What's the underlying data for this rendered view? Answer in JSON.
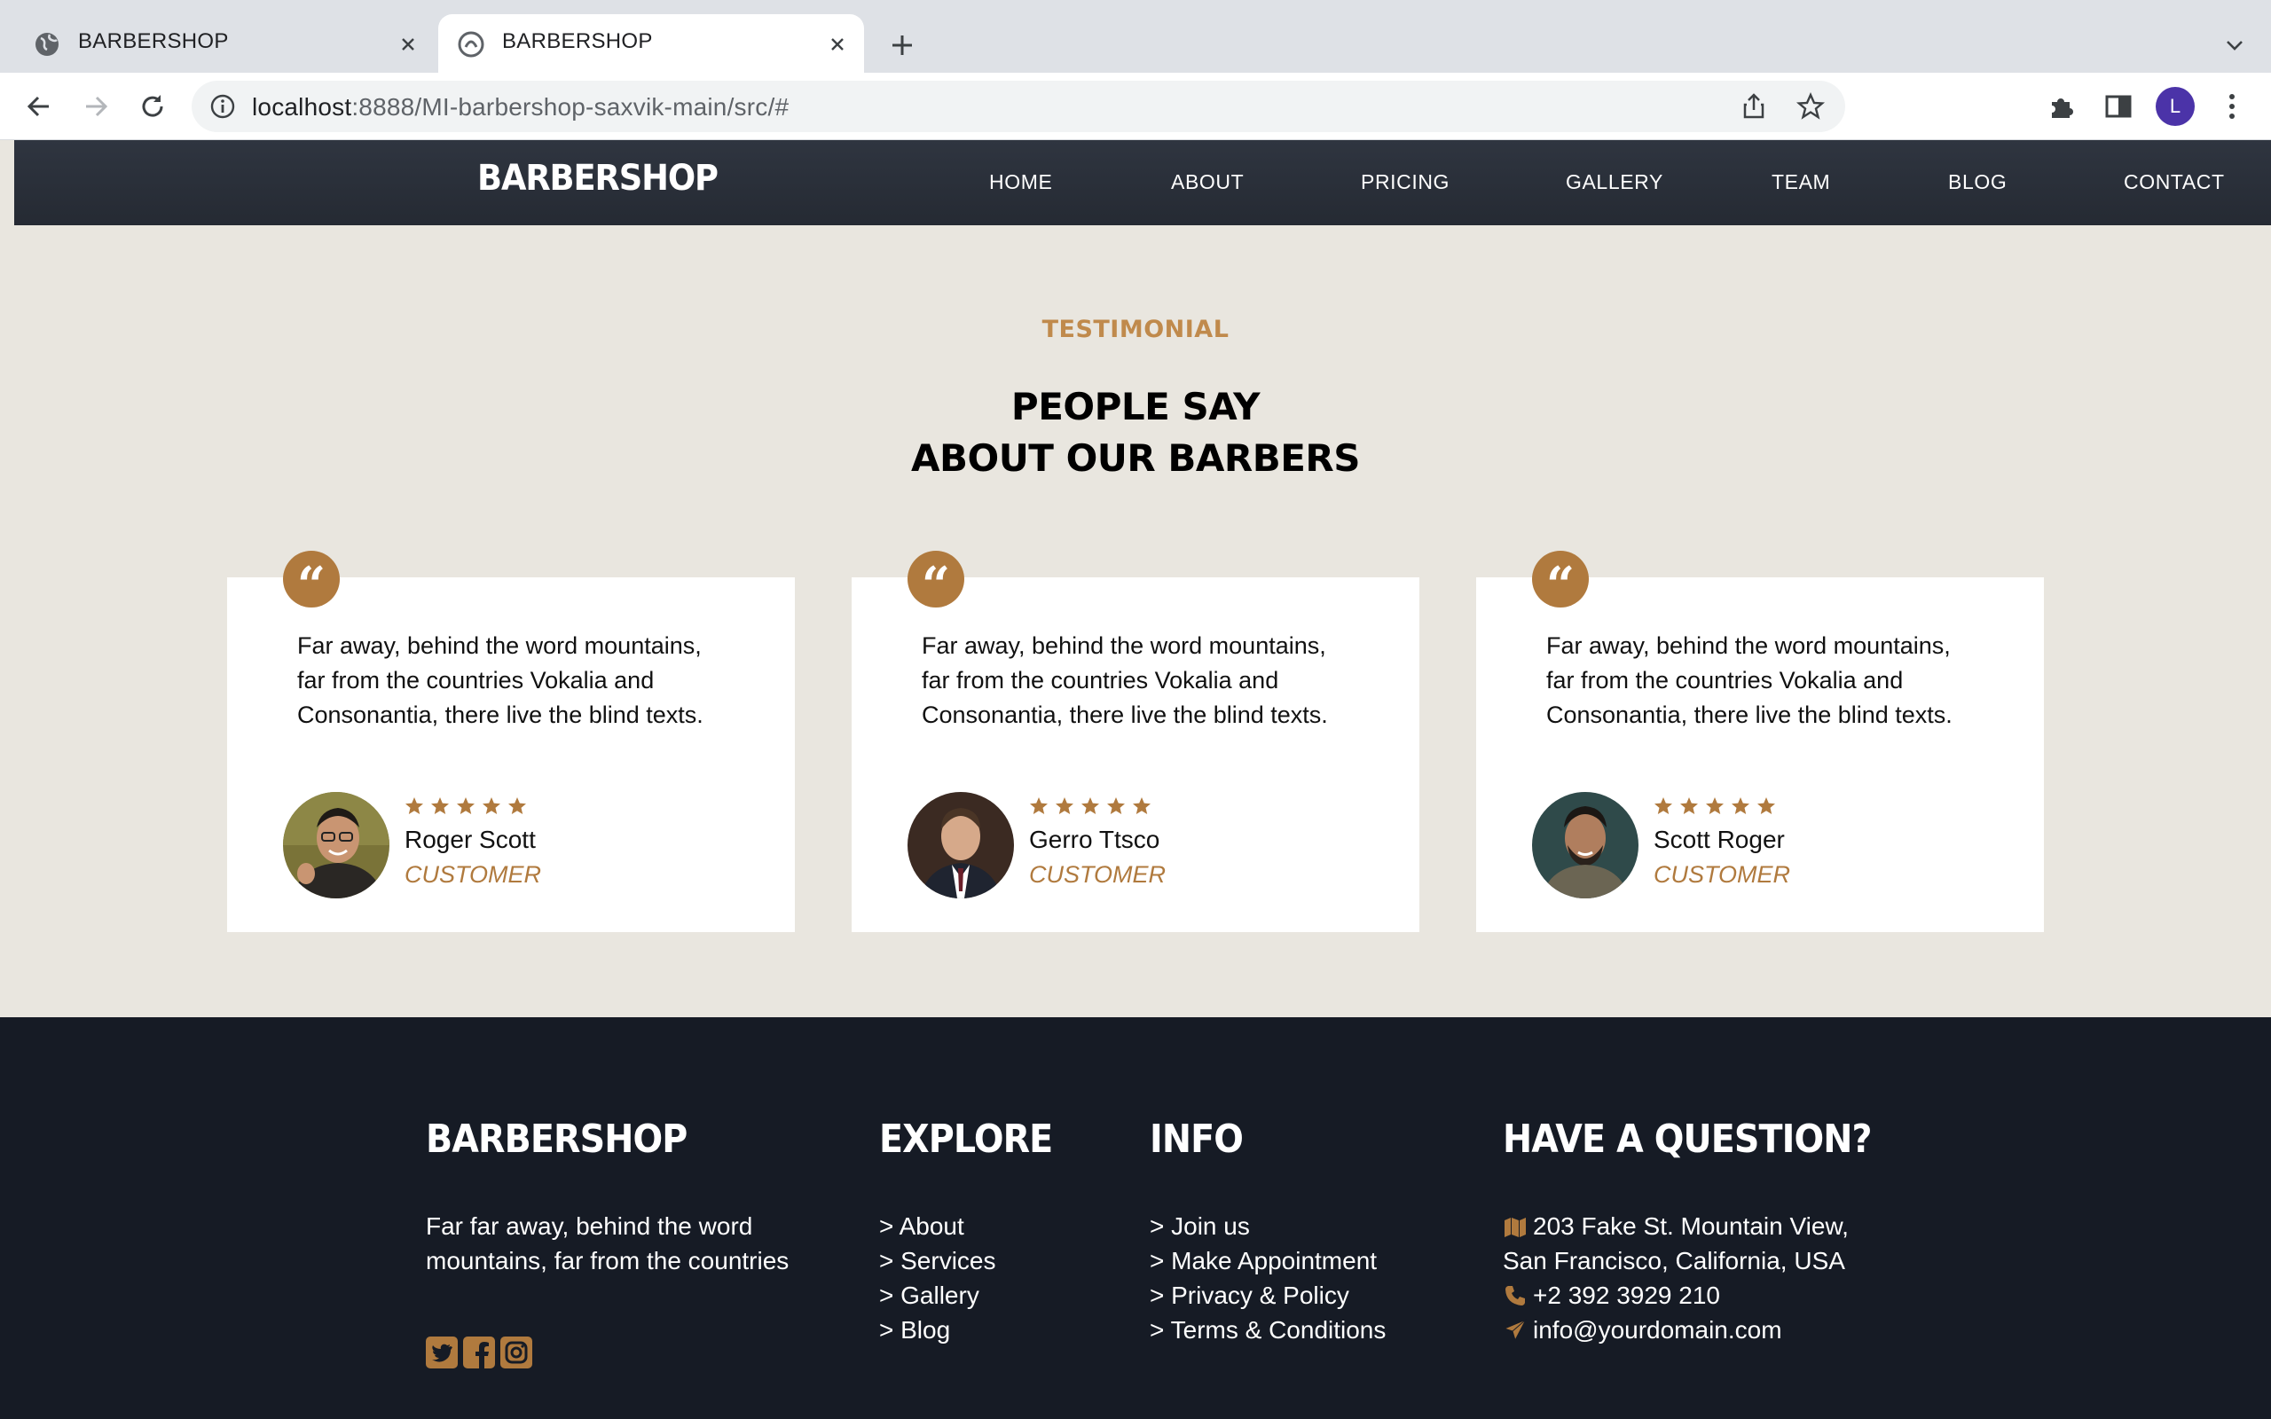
{
  "browser": {
    "tabs": [
      {
        "title": "BARBERSHOP",
        "active": false
      },
      {
        "title": "BARBERSHOP",
        "active": true
      }
    ],
    "url_host": "localhost",
    "url_path": ":8888/MI-barbershop-saxvik-main/src/#",
    "profile_initial": "L"
  },
  "navbar": {
    "brand": "BARBERSHOP",
    "links": [
      "HOME",
      "ABOUT",
      "PRICING",
      "GALLERY",
      "TEAM",
      "BLOG",
      "CONTACT"
    ]
  },
  "testimonial": {
    "subheading": "TESTIMONIAL",
    "heading_line1": "PEOPLE SAY",
    "heading_line2": "ABOUT OUR BARBERS",
    "cards": [
      {
        "text": "Far away, behind the word mountains, far from the countries Vokalia and Consonantia, there live the blind texts.",
        "name": "Roger Scott",
        "role": "CUSTOMER",
        "rating": 5
      },
      {
        "text": "Far away, behind the word mountains, far from the countries Vokalia and Consonantia, there live the blind texts.",
        "name": "Gerro Ttsco",
        "role": "CUSTOMER",
        "rating": 5
      },
      {
        "text": "Far away, behind the word mountains, far from the countries Vokalia and Consonantia, there live the blind texts.",
        "name": "Scott Roger",
        "role": "CUSTOMER",
        "rating": 5
      }
    ]
  },
  "footer": {
    "brand": "BARBERSHOP",
    "about": "Far far away, behind the word mountains, far from the countries",
    "explore": {
      "title": "EXPLORE",
      "items": [
        "> About",
        "> Services",
        "> Gallery",
        "> Blog"
      ]
    },
    "info": {
      "title": "INFO",
      "items": [
        "> Join us",
        "> Make Appointment",
        "> Privacy & Policy",
        "> Terms & Conditions"
      ]
    },
    "question": {
      "title": "HAVE A QUESTION?",
      "address_line1": "203 Fake St. Mountain View,",
      "address_line2": "San Francisco, California, USA",
      "phone": "+2 392 3929 210",
      "email": "info@yourdomain.com"
    }
  },
  "colors": {
    "accent": "#b07a3e",
    "subheading": "#c08a4c",
    "section_bg": "#e9e6df",
    "footer_bg": "#161b25",
    "navbar_bg": "#2a2f38"
  }
}
